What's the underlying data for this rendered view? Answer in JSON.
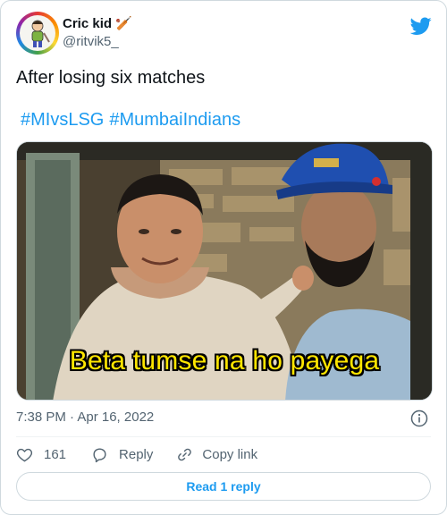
{
  "tweet": {
    "author": {
      "display_name": "Cric kid 🏏",
      "handle": "@ritvik5_",
      "avatar_icon": "cartoon-kid-avatar"
    },
    "text": "After losing six matches",
    "hashtags": [
      "#MIvsLSG",
      "#MumbaiIndians"
    ],
    "media": {
      "caption": "Beta tumse na ho payega"
    },
    "timestamp": "7:38 PM · Apr 16, 2022",
    "likes": "161",
    "reply_label": "Reply",
    "copy_link_label": "Copy link",
    "read_replies_label": "Read 1 reply"
  },
  "colors": {
    "accent": "#1d9bf0",
    "text": "#0f1419",
    "muted": "#536471",
    "border": "#cfd9de",
    "caption": "#ffe600"
  },
  "icons": [
    "twitter-bird-icon",
    "info-icon",
    "heart-icon",
    "reply-bubble-icon",
    "link-icon"
  ]
}
